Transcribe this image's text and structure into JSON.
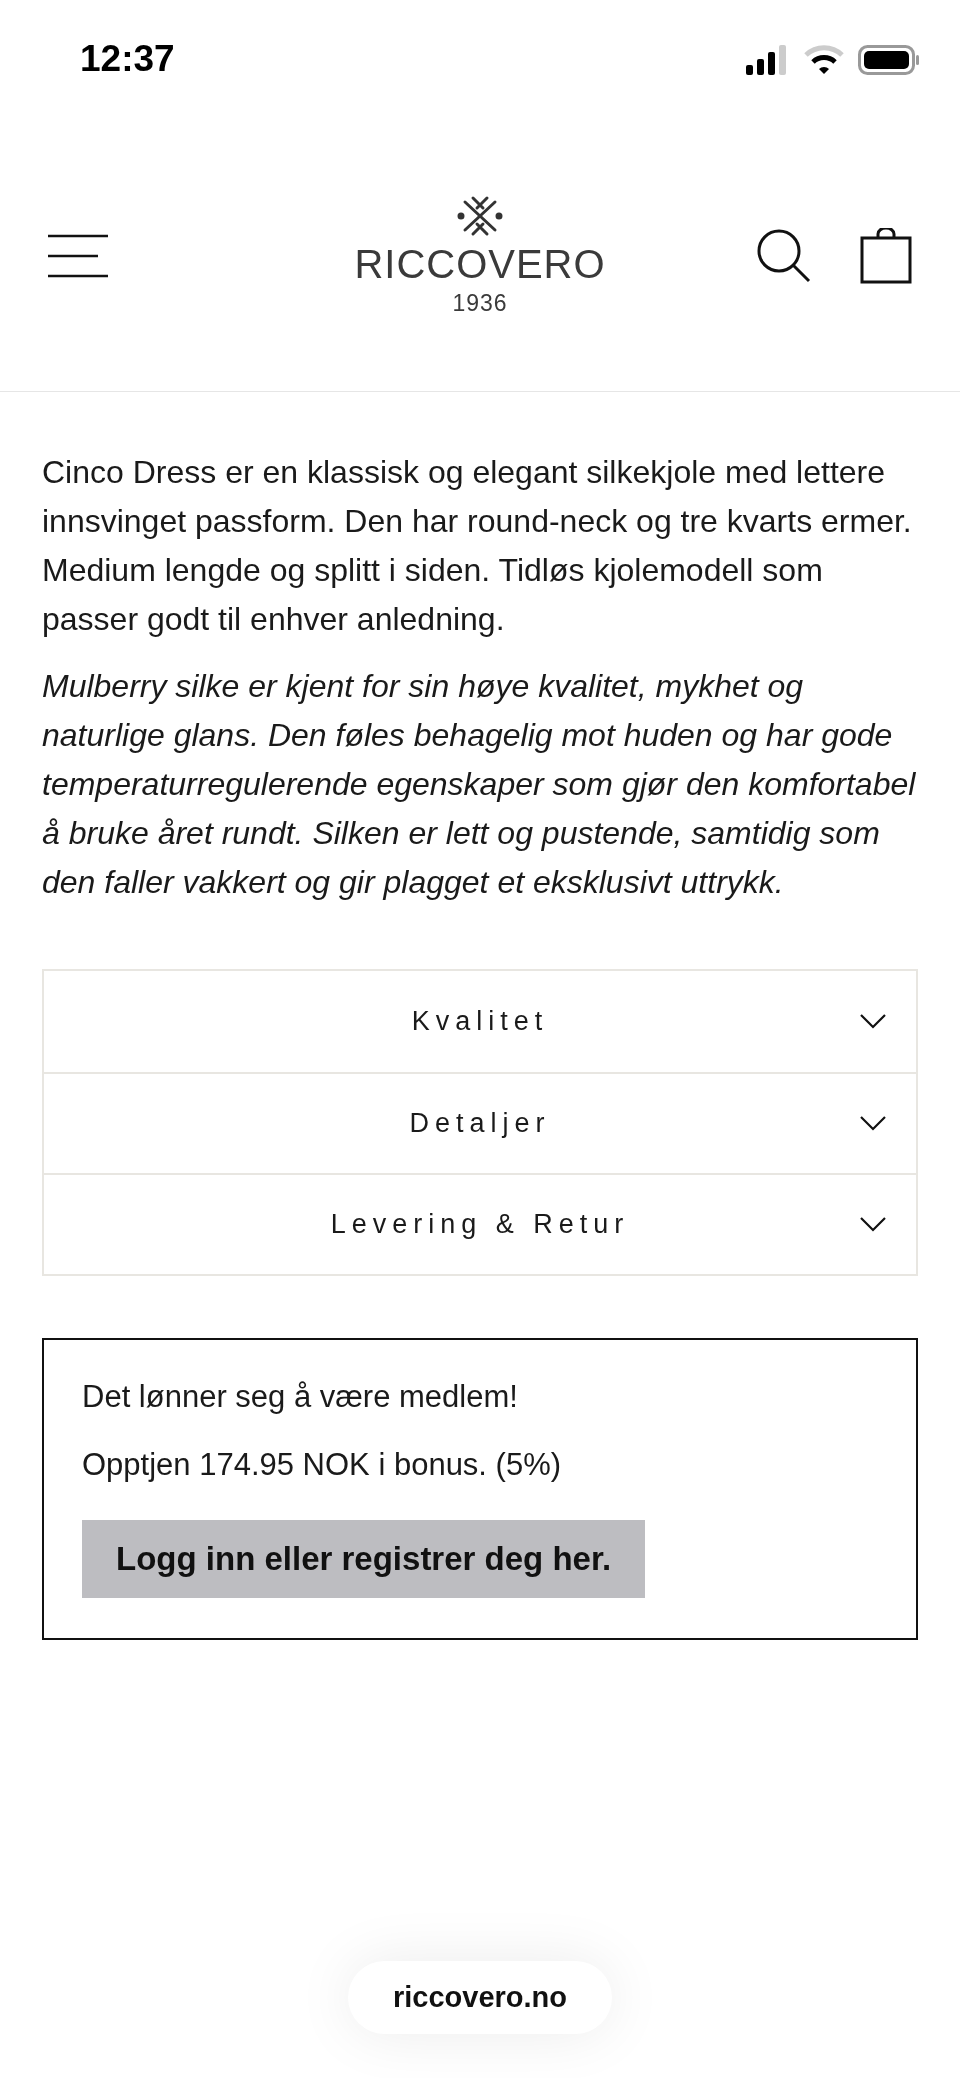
{
  "status_bar": {
    "time": "12:37"
  },
  "header": {
    "brand": "RICCOVERO",
    "year": "1936"
  },
  "description": "Cinco Dress er en klassisk og elegant silkekjole med lettere innsvinget passform. Den har round-neck og tre kvarts ermer. Medium lengde og splitt i siden. Tidløs kjolemodell som passer godt til enhver anledning.",
  "material_note": "Mulberry silke er kjent for sin høye kvalitet, mykhet og naturlige glans. Den føles behagelig mot huden og har gode temperaturregulerende egenskaper som gjør den komfortabel å bruke året rundt. Silken er lett og pustende, samtidig som den faller vakkert og gir plagget et eksklusivt uttrykk.",
  "accordion": [
    {
      "label": "Kvalitet",
      "expanded": false
    },
    {
      "label": "Detaljer",
      "expanded": false
    },
    {
      "label": "Levering & Retur",
      "expanded": false
    }
  ],
  "member_box": {
    "heading": "Det lønner seg å være medlem!",
    "bonus": "Opptjen 174.95 NOK i bonus. (5%)",
    "button": "Logg inn eller registrer deg her."
  },
  "url_pill": "riccovero.no"
}
